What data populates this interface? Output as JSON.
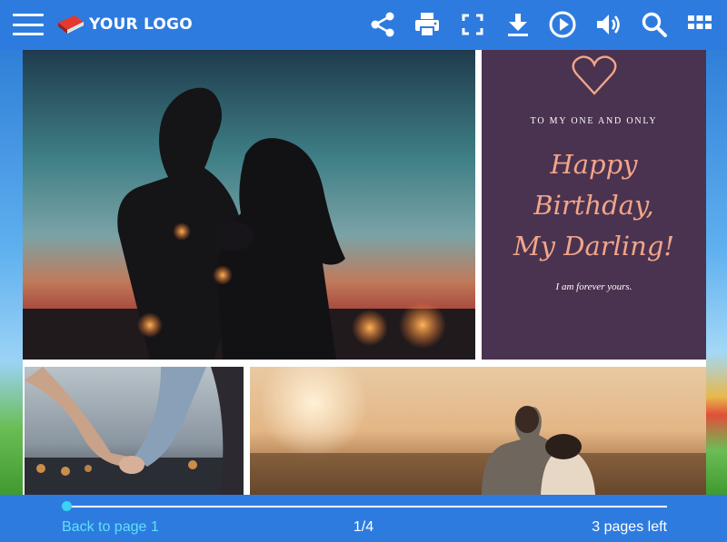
{
  "toolbar": {
    "logo_text": "YOUR LOGO",
    "icons": [
      "menu-icon",
      "share-icon",
      "print-icon",
      "fullscreen-icon",
      "download-icon",
      "autoplay-icon",
      "sound-icon",
      "search-icon",
      "thumbnails-icon"
    ],
    "bar_color": "#2e7be0"
  },
  "card": {
    "subtitle": "TO MY ONE AND ONLY",
    "title_line1": "Happy",
    "title_line2": "Birthday,",
    "title_line3": "My Darling!",
    "note": "I am forever yours.",
    "background": "#4a3350",
    "accent": "#f2a589"
  },
  "footer": {
    "back_link": "Back to page 1",
    "page_indicator": "1/4",
    "pages_left": "3 pages left",
    "progress": 0,
    "accent": "#38d4f2"
  }
}
